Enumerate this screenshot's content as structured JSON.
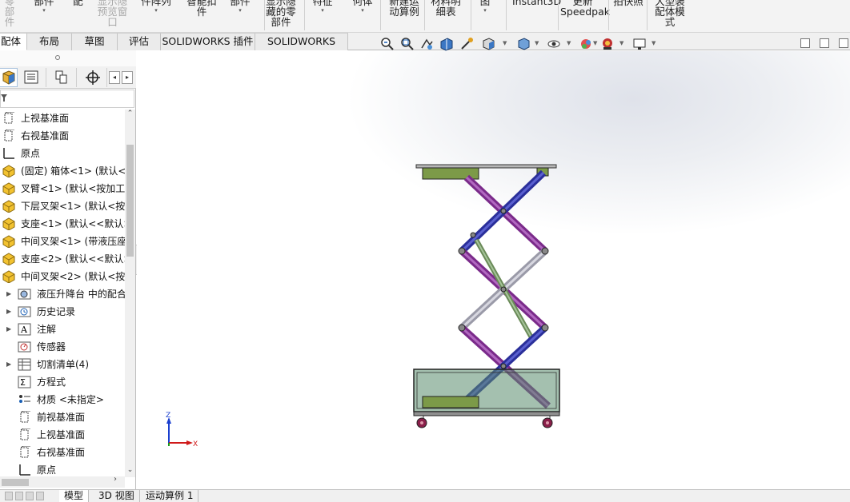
{
  "ribbon": [
    {
      "lines": [
        "零部",
        "件"
      ],
      "gray": true
    },
    {
      "lines": [
        "部件"
      ],
      "gray": false,
      "arrow": true
    },
    {
      "lines": [
        "配"
      ],
      "gray": false
    },
    {
      "lines": [
        "显示隐",
        "预览窗",
        "口"
      ],
      "gray": true
    },
    {
      "lines": [
        "件阵列"
      ],
      "gray": false,
      "arrow": true
    },
    {
      "lines": [
        "智能扣",
        "件"
      ],
      "gray": false
    },
    {
      "lines": [
        "部件"
      ],
      "gray": false,
      "arrow": true
    },
    {
      "lines": [
        "显示隐",
        "藏的零",
        "部件"
      ],
      "gray": false
    },
    {
      "lines": [
        "特征"
      ],
      "gray": false,
      "arrow": true
    },
    {
      "lines": [
        "何体"
      ],
      "gray": false,
      "arrow": true
    },
    {
      "lines": [
        "新建运",
        "动算例"
      ],
      "gray": false
    },
    {
      "lines": [
        "材料明",
        "细表"
      ],
      "gray": false
    },
    {
      "lines": [
        "图"
      ],
      "gray": false,
      "arrow": true
    },
    {
      "lines": [
        "Instant3D"
      ],
      "gray": false
    },
    {
      "lines": [
        "更新",
        "Speedpak"
      ],
      "gray": false
    },
    {
      "lines": [
        "拍快照"
      ],
      "gray": false
    },
    {
      "lines": [
        "大型装",
        "配体模",
        "式"
      ],
      "gray": false
    }
  ],
  "tabs": [
    "配体",
    "布局",
    "草图",
    "评估",
    "SOLIDWORKS 插件",
    "SOLIDWORKS MBD"
  ],
  "active_tab": "配体",
  "tree": [
    {
      "label": "上视基准面",
      "icon": "plane-icon",
      "indent": 0
    },
    {
      "label": "右视基准面",
      "icon": "plane-icon",
      "indent": 0
    },
    {
      "label": "原点",
      "icon": "origin-icon",
      "indent": 0
    },
    {
      "label": "(固定) 箱体<1> (默认<",
      "icon": "part-icon",
      "indent": 0
    },
    {
      "label": "叉臂<1> (默认<按加工",
      "icon": "part-icon",
      "indent": 0
    },
    {
      "label": "下层叉架<1> (默认<按",
      "icon": "part-icon",
      "indent": 0
    },
    {
      "label": "支座<1> (默认<<默认>",
      "icon": "part-icon",
      "indent": 0
    },
    {
      "label": "中间叉架<1> (带液压座",
      "icon": "part-icon",
      "indent": 0
    },
    {
      "label": "支座<2> (默认<<默认>",
      "icon": "part-icon",
      "indent": 0
    },
    {
      "label": "中间叉架<2> (默认<按",
      "icon": "part-icon",
      "indent": 0
    },
    {
      "label": "液压升降台 中的配合",
      "icon": "mates-icon",
      "indent": 1,
      "expand": true
    },
    {
      "label": "历史记录",
      "icon": "history-icon",
      "indent": 1,
      "expand": true
    },
    {
      "label": "注解",
      "icon": "annotation-icon",
      "indent": 1,
      "expand": true
    },
    {
      "label": "传感器",
      "icon": "sensor-icon",
      "indent": 1
    },
    {
      "label": "切割清单(4)",
      "icon": "cutlist-icon",
      "indent": 1,
      "expand": true
    },
    {
      "label": "方程式",
      "icon": "equation-icon",
      "indent": 1
    },
    {
      "label": "材质 <未指定>",
      "icon": "material-icon",
      "indent": 1
    },
    {
      "label": "前视基准面",
      "icon": "plane-icon",
      "indent": 1
    },
    {
      "label": "上视基准面",
      "icon": "plane-icon",
      "indent": 1
    },
    {
      "label": "右视基准面",
      "icon": "plane-icon",
      "indent": 1
    },
    {
      "label": "原点",
      "icon": "origin-icon",
      "indent": 1
    }
  ],
  "triad": {
    "z": "Z",
    "x": "X"
  },
  "bottom_tabs": [
    "模型",
    "3D 视图",
    "运动算例 1"
  ],
  "active_bottom_tab": "模型",
  "colors": {
    "accent": "#1a5fb4",
    "link_gray": "#a8a8a8",
    "model_green": "#7c9a48",
    "model_purple": "#7a2a8a",
    "model_blue": "#2a2f9a"
  }
}
